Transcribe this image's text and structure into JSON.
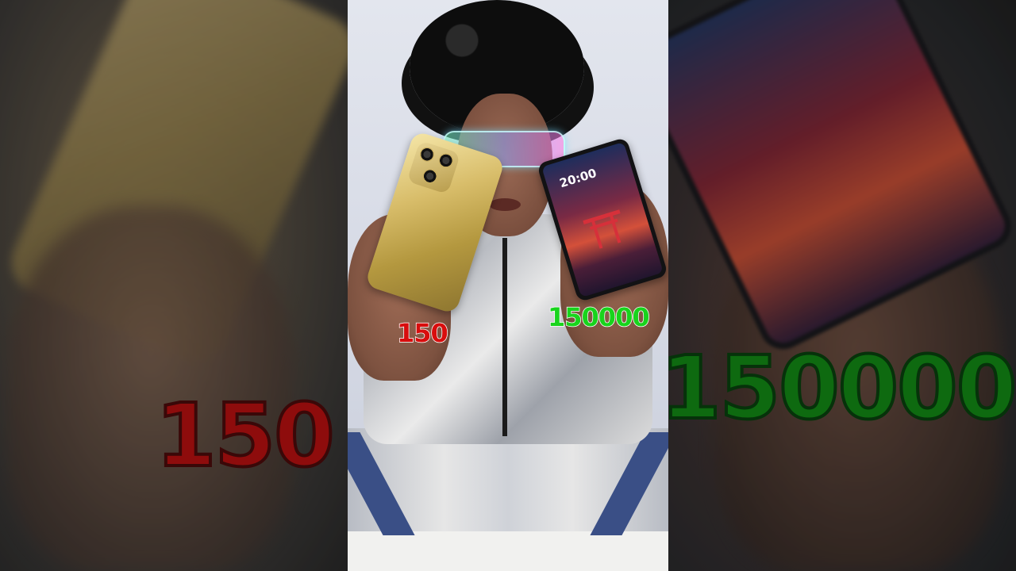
{
  "left_panel": {
    "label": "150",
    "color": "#8e0c0c"
  },
  "right_panel": {
    "label": "150000",
    "color": "#0e6a10"
  },
  "video": {
    "cheap_phone_price": "150",
    "cheap_phone_price_color": "#d80d0d",
    "expensive_phone_price": "150000",
    "expensive_phone_price_color": "#18d41c",
    "lock_screen_time": "20:00"
  }
}
